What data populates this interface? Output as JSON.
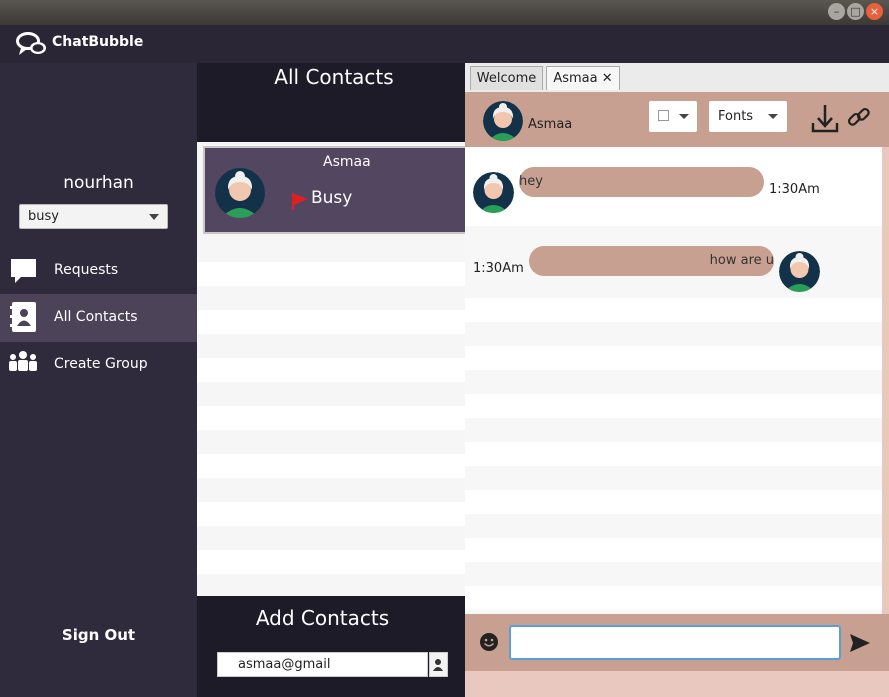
{
  "window": {
    "controls": [
      "minimize",
      "maximize",
      "close"
    ]
  },
  "app": {
    "brand": "ChatBubble"
  },
  "sidebar": {
    "username": "nourhan",
    "status_value": "busy",
    "items": [
      {
        "label": "Requests",
        "icon": "chat-bubble-icon"
      },
      {
        "label": "All Contacts",
        "icon": "contacts-book-icon",
        "active": true
      },
      {
        "label": "Create Group",
        "icon": "group-icon"
      }
    ],
    "signout_label": "Sign Out"
  },
  "contacts": {
    "title": "All Contacts",
    "list": [
      {
        "name": "Asmaa",
        "status": "Busy",
        "status_color": "#e02020"
      }
    ],
    "add_title": "Add Contacts",
    "add_input_value": "asmaa@gmail"
  },
  "chat": {
    "tabs": [
      {
        "label": "Welcome"
      },
      {
        "label": "Asmaa",
        "close": "✕"
      }
    ],
    "header_name": "Asmaa",
    "fonts_label": "Fonts",
    "messages": [
      {
        "side": "received",
        "text": "hey",
        "time": "1:30Am"
      },
      {
        "side": "sent",
        "text": "how are u",
        "time": "1:30Am"
      }
    ],
    "composer_value": ""
  },
  "colors": {
    "sidebar_bg": "#302a3d",
    "header_bg": "#1e1b29",
    "accent": "#c8a091",
    "active_item": "#4c4359"
  }
}
